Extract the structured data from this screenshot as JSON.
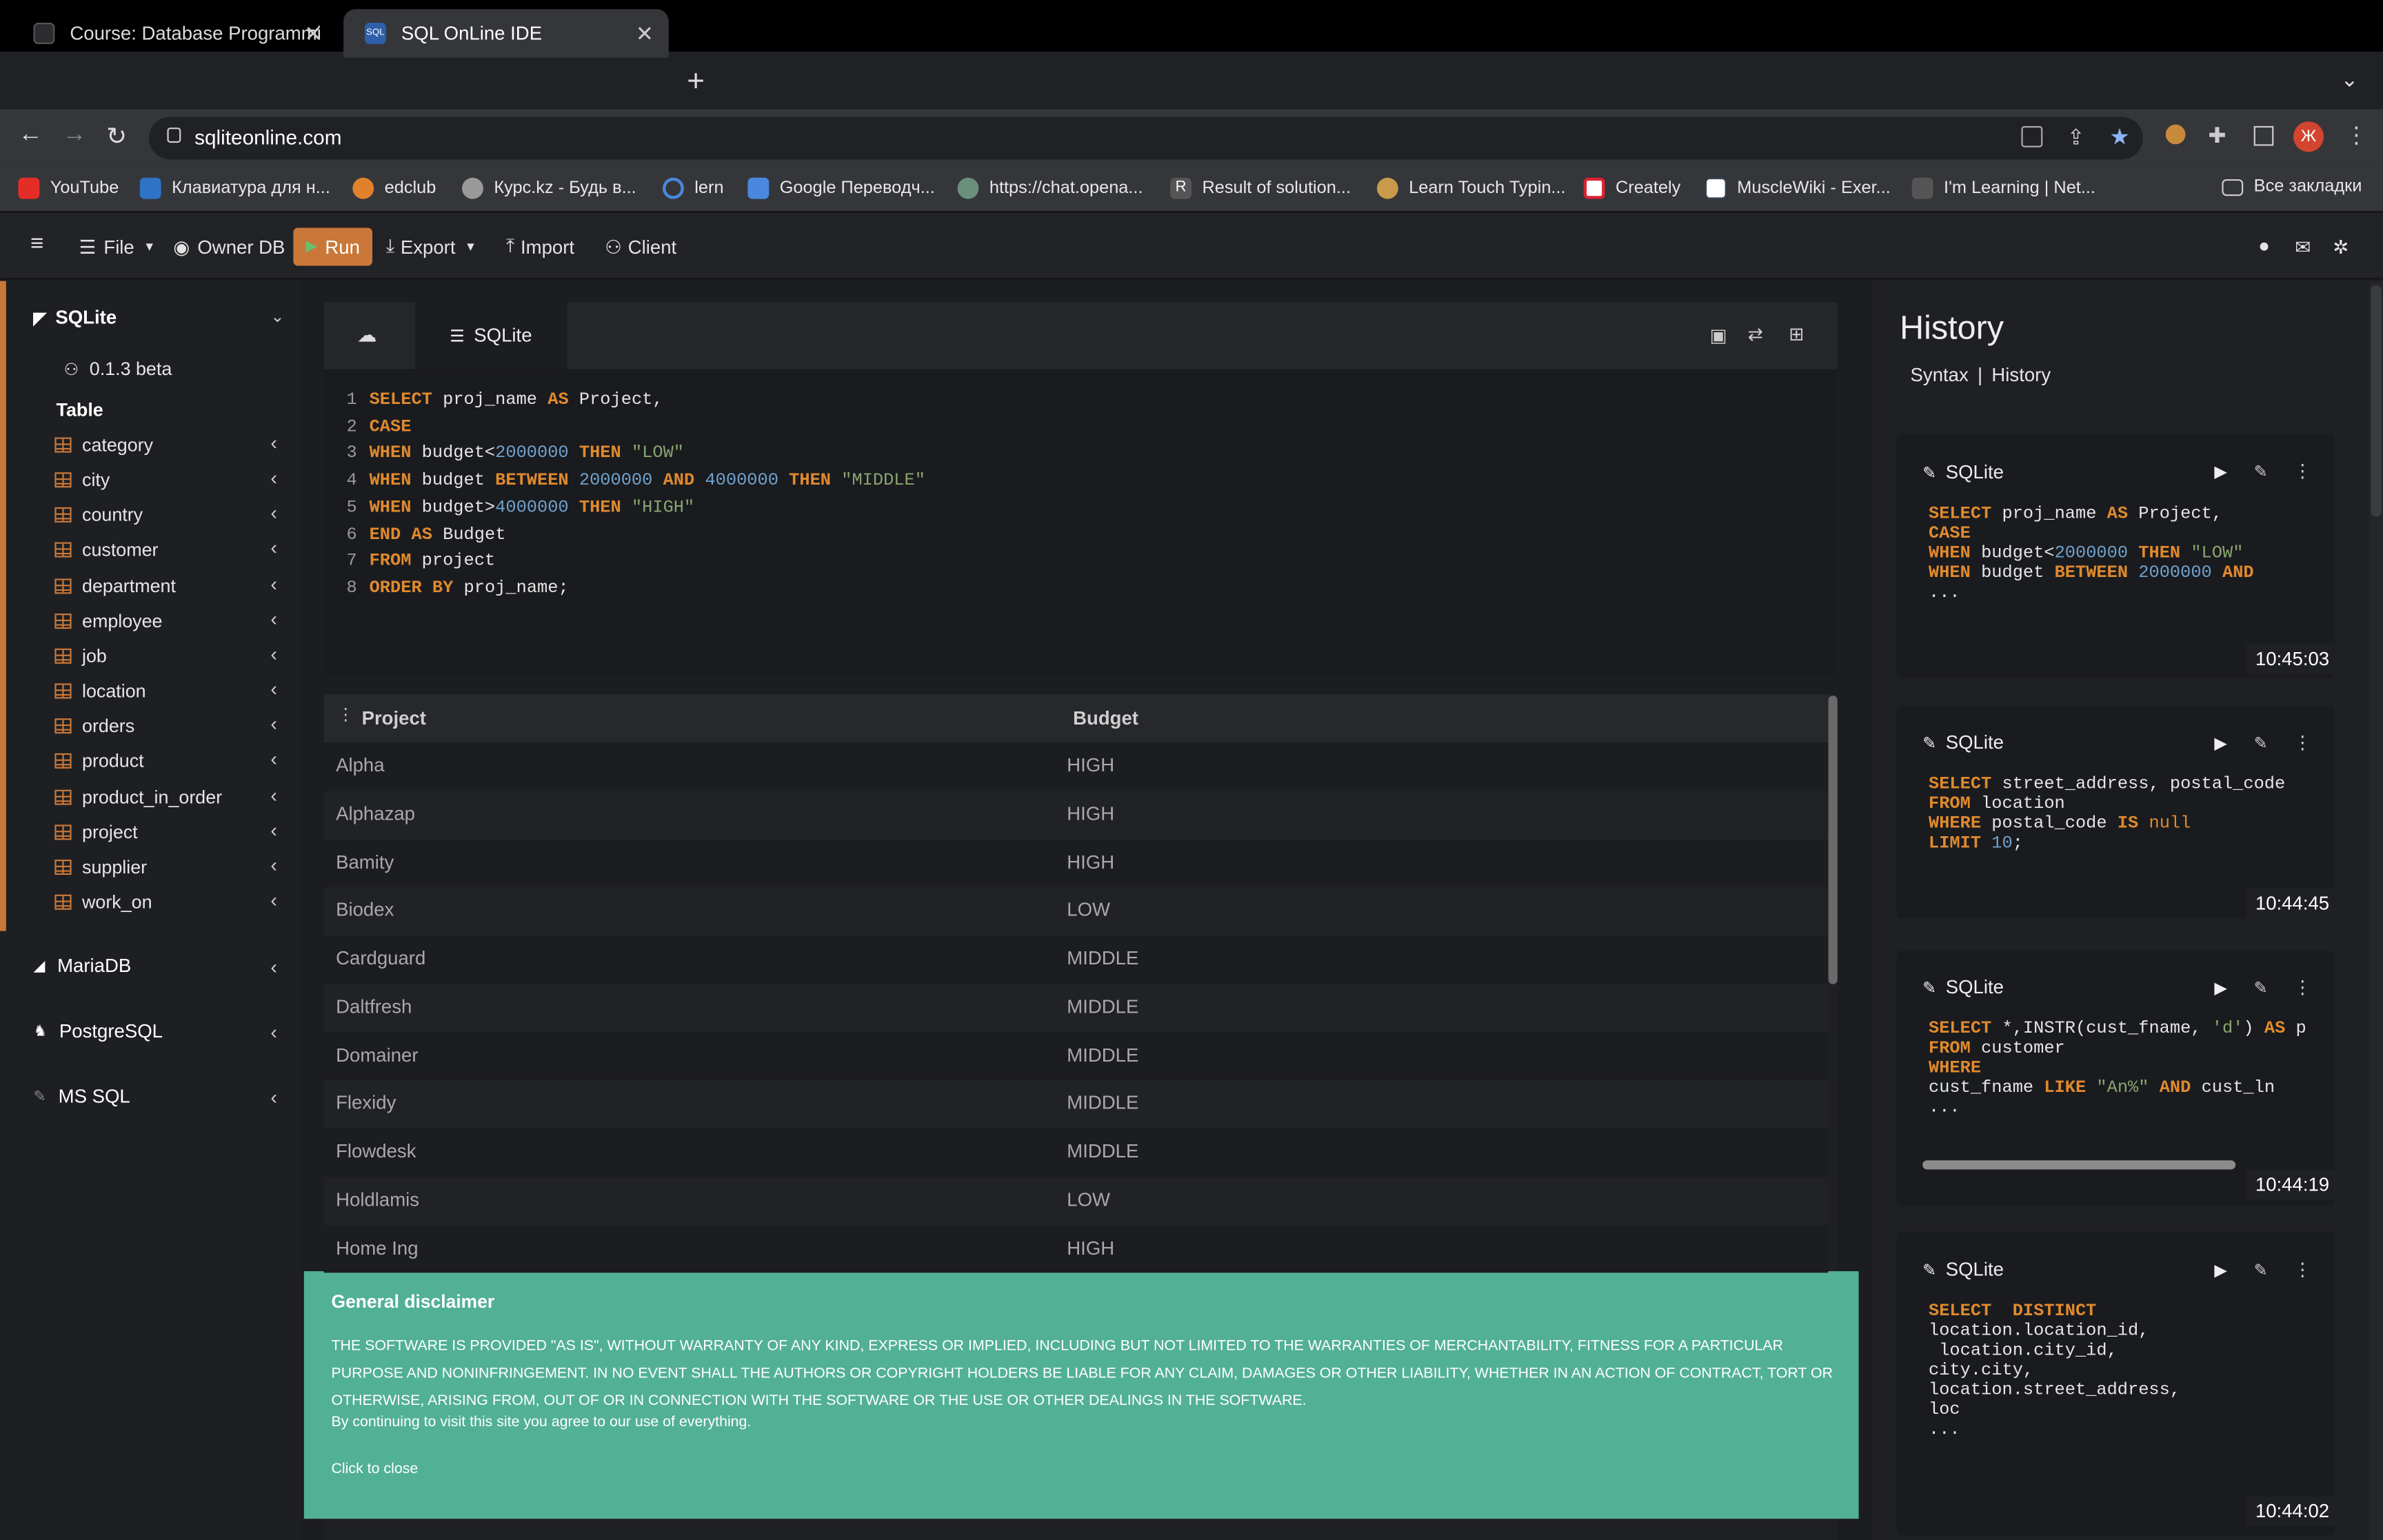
{
  "browser": {
    "tabs": [
      {
        "title": "Course: Database Programmi"
      },
      {
        "title": "SQL OnLine IDE"
      }
    ],
    "url": "sqliteonline.com",
    "bookmarks": [
      "YouTube",
      "Клавиатура для н...",
      "edclub",
      "Курс.kz - Будь в...",
      "lern",
      "Google Переводч...",
      "https://chat.opena...",
      "Result of solution...",
      "Learn Touch Typin...",
      "Creately",
      "MuscleWiki - Exer...",
      "I'm Learning | Net..."
    ],
    "all_bookmarks": "Все закладки",
    "profile_initial": "Ж"
  },
  "toolbar": {
    "file": "File",
    "owner_db": "Owner DB",
    "run": "Run",
    "export": "Export",
    "import": "Import",
    "client": "Client"
  },
  "sidebar": {
    "sqlite": {
      "name": "SQLite",
      "version": "0.1.3 beta",
      "table_header": "Table",
      "tables": [
        "category",
        "city",
        "country",
        "customer",
        "department",
        "employee",
        "job",
        "location",
        "orders",
        "product",
        "product_in_order",
        "project",
        "supplier",
        "work_on"
      ]
    },
    "others": [
      "MariaDB",
      "PostgreSQL",
      "MS SQL"
    ]
  },
  "editor": {
    "tab": "SQLite",
    "line_numbers": [
      "1",
      "2",
      "3",
      "4",
      "5",
      "6",
      "7",
      "8"
    ]
  },
  "results": {
    "columns": [
      "Project",
      "Budget"
    ],
    "rows": [
      [
        "Alpha",
        "HIGH"
      ],
      [
        "Alphazap",
        "HIGH"
      ],
      [
        "Bamity",
        "HIGH"
      ],
      [
        "Biodex",
        "LOW"
      ],
      [
        "Cardguard",
        "MIDDLE"
      ],
      [
        "Daltfresh",
        "MIDDLE"
      ],
      [
        "Domainer",
        "MIDDLE"
      ],
      [
        "Flexidy",
        "MIDDLE"
      ],
      [
        "Flowdesk",
        "MIDDLE"
      ],
      [
        "Holdlamis",
        "LOW"
      ],
      [
        "Home Ing",
        "HIGH"
      ]
    ]
  },
  "disclaimer": {
    "title": "General disclaimer",
    "body": "THE SOFTWARE IS PROVIDED \"AS IS\", WITHOUT WARRANTY OF ANY KIND, EXPRESS OR IMPLIED, INCLUDING BUT NOT LIMITED TO THE WARRANTIES OF MERCHANTABILITY, FITNESS FOR A PARTICULAR PURPOSE AND NONINFRINGEMENT. IN NO EVENT SHALL THE AUTHORS OR COPYRIGHT HOLDERS BE LIABLE FOR ANY CLAIM, DAMAGES OR OTHER LIABILITY, WHETHER IN AN ACTION OF CONTRACT, TORT OR OTHERWISE, ARISING FROM, OUT OF OR IN CONNECTION WITH THE SOFTWARE OR THE USE OR OTHER DEALINGS IN THE SOFTWARE.",
    "agree": "By continuing to visit this site you agree to our use of everything.",
    "close": "Click to close"
  },
  "history": {
    "title": "History",
    "syntax_link": "Syntax",
    "sep": "|",
    "history_link": "History",
    "cards": [
      {
        "db": "SQLite",
        "time": "10:45:03"
      },
      {
        "db": "SQLite",
        "time": "10:44:45"
      },
      {
        "db": "SQLite",
        "time": "10:44:19"
      },
      {
        "db": "SQLite",
        "time": "10:44:02"
      }
    ]
  },
  "colors": {
    "accent": "#c9783a",
    "keyword": "#e08a2e",
    "number": "#6fa3cf",
    "string": "#8aa571",
    "disclaimer_bg": "#52b095"
  }
}
